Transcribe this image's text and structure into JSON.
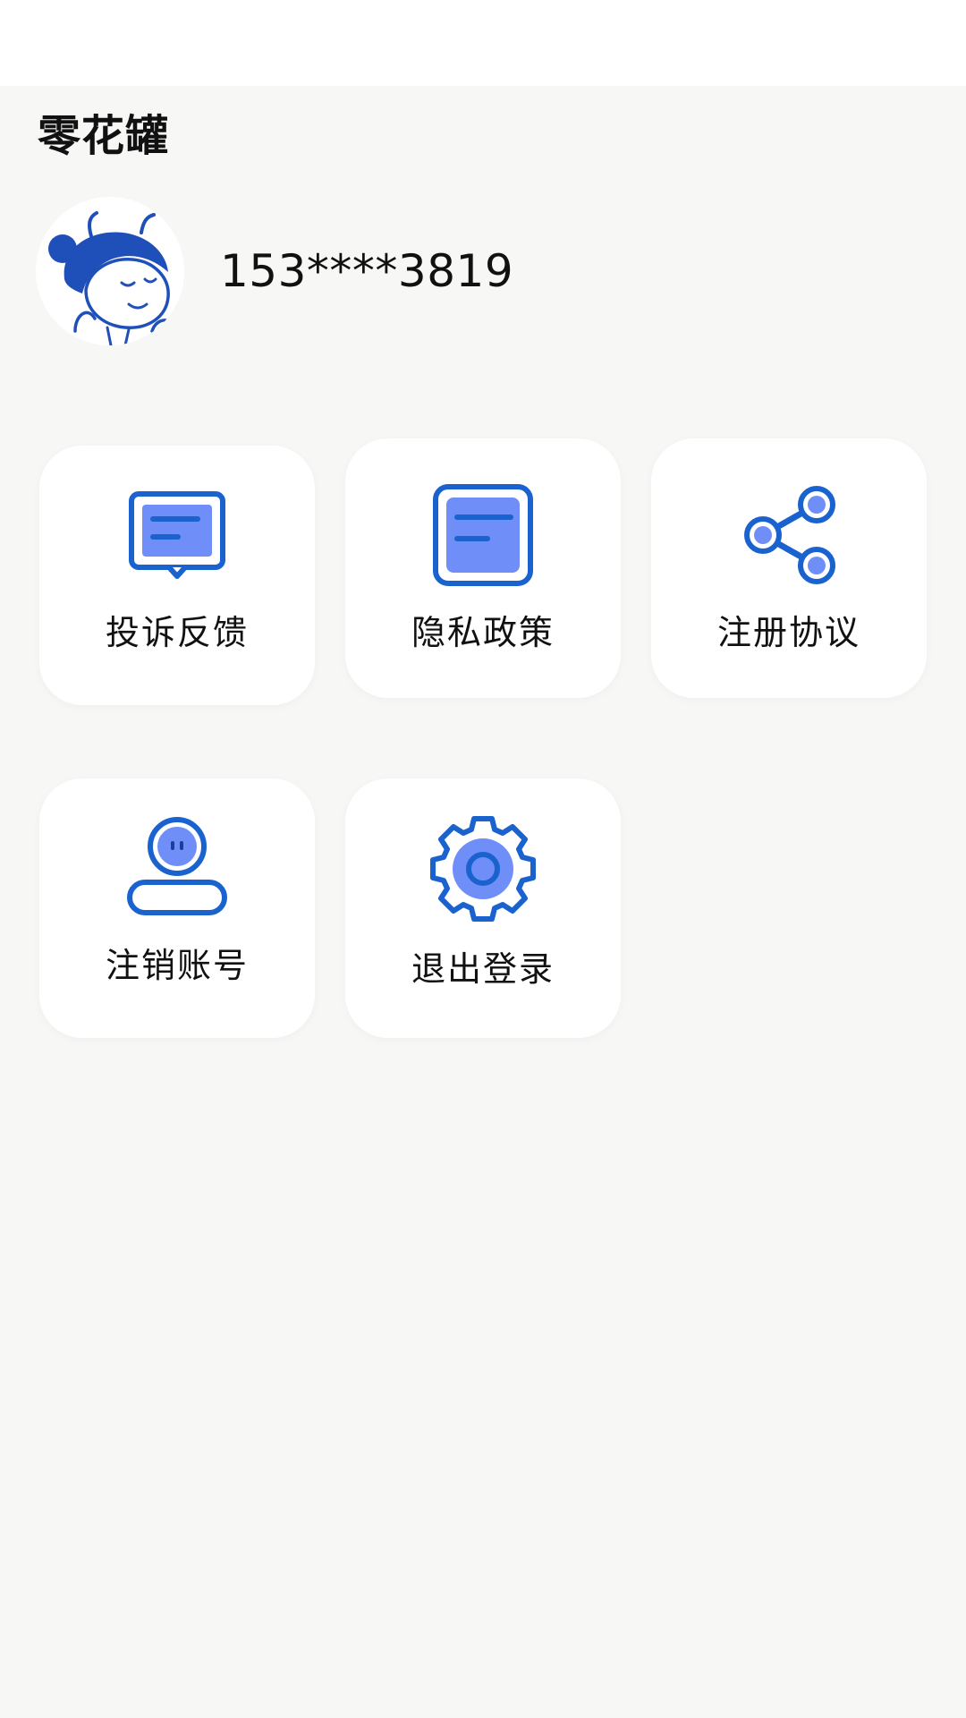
{
  "app": {
    "title": "零花罐"
  },
  "profile": {
    "phone": "153****3819",
    "avatar_icon": "cartoon-girl-avatar"
  },
  "menu": {
    "items": [
      {
        "label": "投诉反馈",
        "icon": "feedback-message-icon"
      },
      {
        "label": "隐私政策",
        "icon": "privacy-document-icon"
      },
      {
        "label": "注册协议",
        "icon": "share-agreement-icon"
      },
      {
        "label": "注销账号",
        "icon": "delete-account-user-icon"
      },
      {
        "label": "退出登录",
        "icon": "logout-gear-icon"
      }
    ]
  },
  "colors": {
    "icon_stroke": "#1a63cf",
    "icon_fill": "#6f8ef7",
    "background": "#f7f7f6",
    "tile": "#ffffff"
  }
}
